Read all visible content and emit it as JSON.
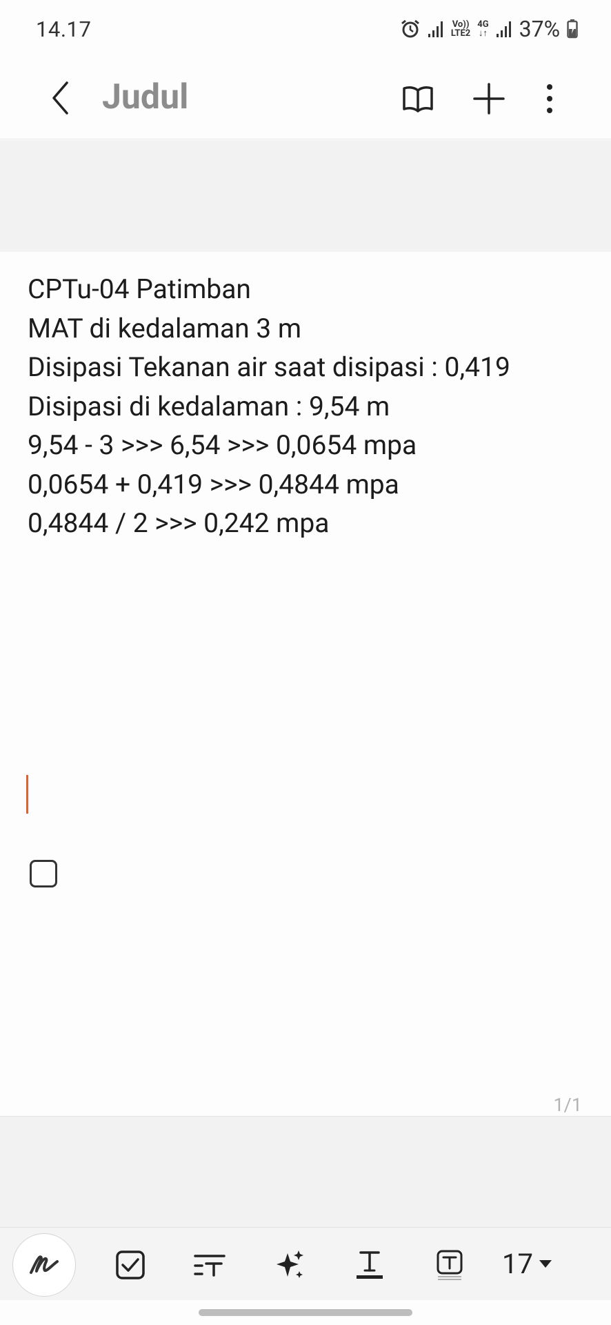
{
  "status_bar": {
    "time": "14.17",
    "volte_label_top": "Vo))",
    "volte_label_bottom": "LTE2",
    "network_label": "4G",
    "battery_percent": "37%"
  },
  "app_bar": {
    "title": "Judul",
    "icons": {
      "back": "chevron-left-icon",
      "reading_mode": "open-book-icon",
      "add": "plus-icon",
      "more": "more-vertical-icon"
    }
  },
  "note": {
    "lines": [
      "CPTu-04 Patimban",
      "MAT di kedalaman 3 m",
      "Disipasi Tekanan air saat disipasi : 0,419",
      "Disipasi di kedalaman : 9,54 m",
      "9,54 - 3 >>> 6,54 >>> 0,0654 mpa",
      "0,0654 + 0,419 >>> 0,4844 mpa",
      "0,4844 / 2 >>> 0,242 mpa"
    ],
    "page_counter": "1/1"
  },
  "toolbar": {
    "font_size": "17",
    "tools": [
      "pen-icon",
      "checkbox-icon",
      "text-style-icon",
      "ai-sparkle-icon",
      "text-color-icon",
      "text-box-icon"
    ]
  },
  "colors": {
    "cursor": "#e06036",
    "title": "#8c8c8c",
    "band": "#f2f2f2"
  }
}
